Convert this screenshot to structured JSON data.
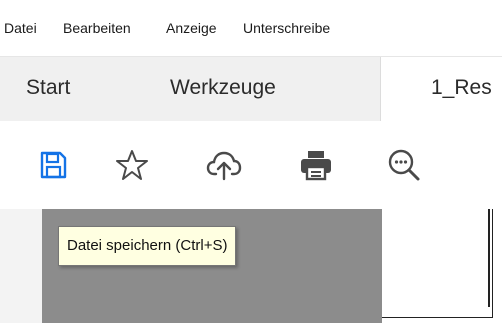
{
  "menu": {
    "items": [
      {
        "label": "Datei"
      },
      {
        "label": "Bearbeiten"
      },
      {
        "label": "Anzeige"
      },
      {
        "label": "Unterschreibe"
      }
    ]
  },
  "tabs": {
    "start": "Start",
    "tools": "Werkzeuge",
    "document": "1_Res"
  },
  "toolbar": {
    "icons": [
      "save-icon",
      "star-icon",
      "cloud-upload-icon",
      "print-icon",
      "zoom-out-icon"
    ],
    "accent_color": "#1473e6"
  },
  "tooltip": {
    "text": "Datei speichern (Ctrl+S)"
  }
}
